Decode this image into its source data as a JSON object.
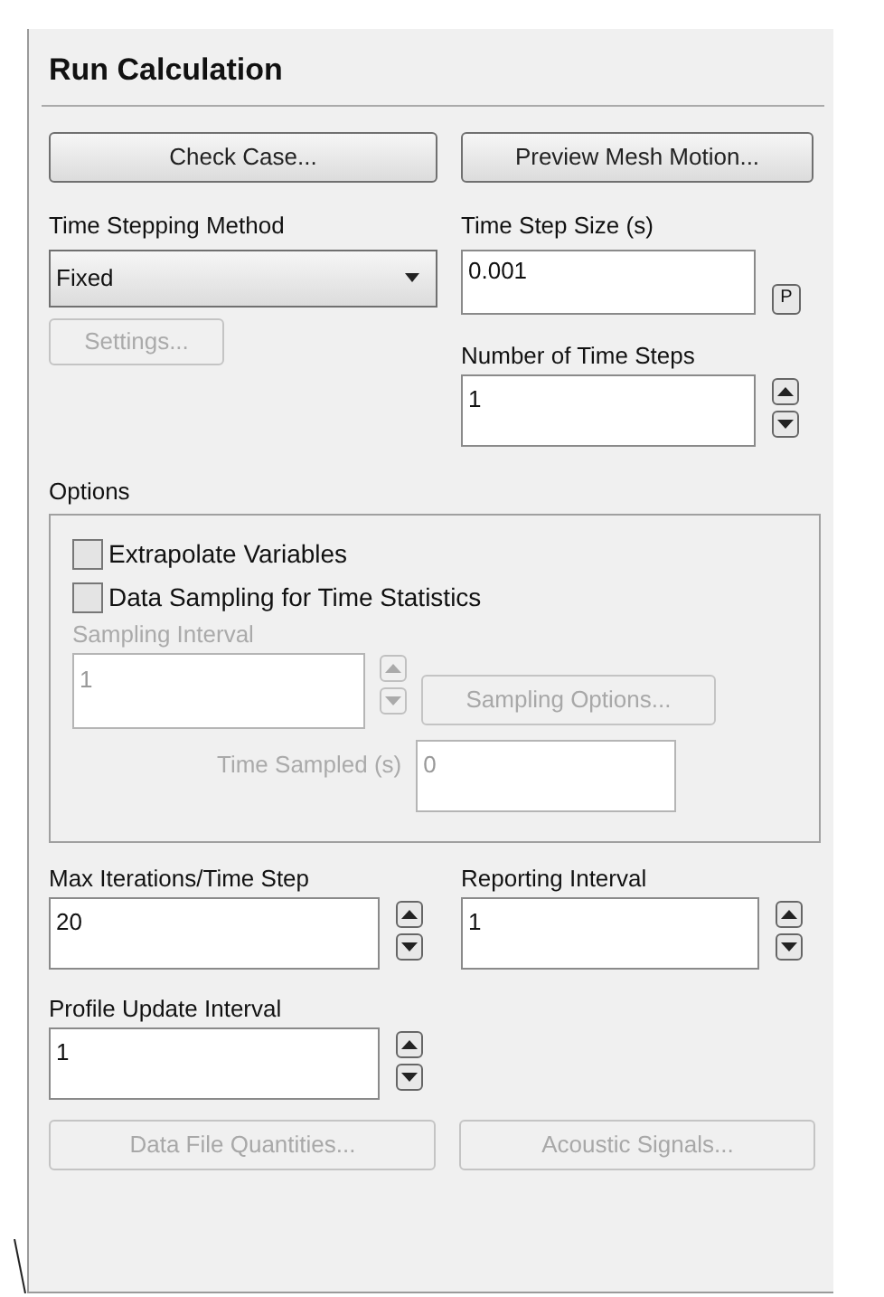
{
  "panel": {
    "title": "Run Calculation"
  },
  "top_buttons": [
    {
      "label": "Check Case...",
      "disabled": false
    },
    {
      "label": "Preview Mesh Motion...",
      "disabled": false
    }
  ],
  "time_stepping_method": {
    "label": "Time Stepping Method",
    "value": "Fixed"
  },
  "settings_button": {
    "label": "Settings...",
    "disabled": true
  },
  "time_step_size": {
    "label": "Time Step Size (s)",
    "value": "0.001",
    "parameter_button": "P"
  },
  "number_of_time_steps": {
    "label": "Number of Time Steps",
    "value": "1"
  },
  "options": {
    "title": "Options",
    "checkboxes": [
      {
        "label": "Extrapolate Variables",
        "checked": false
      },
      {
        "label": "Data Sampling for Time Statistics",
        "checked": false
      }
    ],
    "sampling_interval": {
      "label": "Sampling Interval",
      "value": "1",
      "disabled": true
    },
    "sampling_options_button": {
      "label": "Sampling Options...",
      "disabled": true
    },
    "time_sampled": {
      "label": "Time Sampled (s)",
      "value": "0",
      "disabled": true
    }
  },
  "max_iterations": {
    "label": "Max Iterations/Time Step",
    "value": "20"
  },
  "reporting_interval": {
    "label": "Reporting Interval",
    "value": "1"
  },
  "profile_update_interval": {
    "label": "Profile Update Interval",
    "value": "1"
  },
  "bottom_buttons": [
    {
      "label": "Data File Quantities...",
      "disabled": true
    },
    {
      "label": "Acoustic Signals...",
      "disabled": true
    }
  ]
}
